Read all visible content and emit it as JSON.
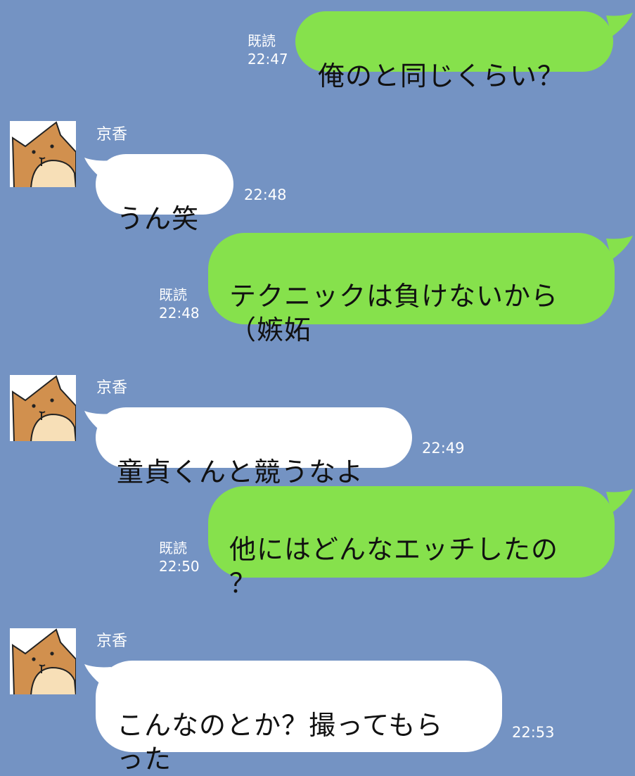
{
  "colors": {
    "background": "#7493c3",
    "outgoing_bubble": "#86e14c",
    "incoming_bubble": "#ffffff",
    "meta_text": "#ffffff"
  },
  "messages": [
    {
      "direction": "out",
      "text": "俺のと同じくらい？",
      "read_label": "既読",
      "time": "22:47"
    },
    {
      "direction": "in",
      "sender": "京香",
      "text": "うん笑",
      "time": "22:48"
    },
    {
      "direction": "out",
      "text": "テクニックは負けないから\n（嫉妬",
      "read_label": "既読",
      "time": "22:48"
    },
    {
      "direction": "in",
      "sender": "京香",
      "text": "童貞くんと競うなよ",
      "time": "22:49"
    },
    {
      "direction": "out",
      "text": "他にはどんなエッチしたの\n？",
      "read_label": "既読",
      "time": "22:50"
    },
    {
      "direction": "in",
      "sender": "京香",
      "text": "こんなのとか？撮ってもら\nった",
      "time": "22:53"
    }
  ],
  "icons": {
    "avatar": "shiba-dog-avatar-icon"
  }
}
